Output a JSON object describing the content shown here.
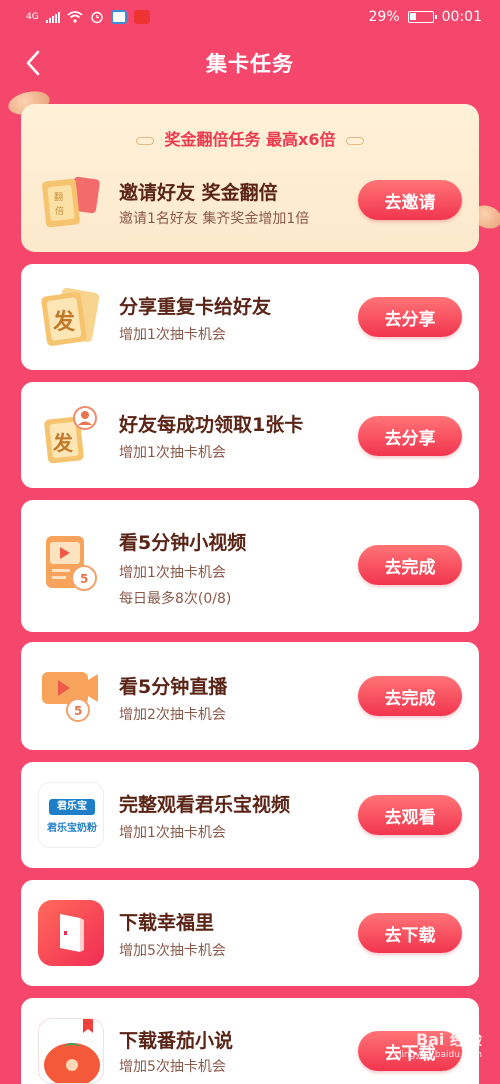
{
  "status_bar": {
    "network": "4G",
    "battery": "29%",
    "time": "00:01"
  },
  "header": {
    "title": "集卡任务"
  },
  "bonus": {
    "title": "奖金翻倍任务 最高x6倍",
    "task": {
      "name": "邀请好友 奖金翻倍",
      "sub": "邀请1名好友 集齐奖金增加1倍",
      "button": "去邀请",
      "icon": "invite-cards-icon"
    }
  },
  "tasks": [
    {
      "name": "分享重复卡给好友",
      "sub": "增加1次抽卡机会",
      "button": "去分享",
      "icon": "share-card-icon",
      "glyph": "发"
    },
    {
      "name": "好友每成功领取1张卡",
      "sub": "增加1次抽卡机会",
      "button": "去分享",
      "icon": "friend-card-icon",
      "glyph": "发"
    },
    {
      "name": "看5分钟小视频",
      "sub": "增加1次抽卡机会",
      "sub2": "每日最多8次(0/8)",
      "button": "去完成",
      "icon": "short-video-icon"
    },
    {
      "name": "看5分钟直播",
      "sub": "增加2次抽卡机会",
      "button": "去完成",
      "icon": "live-stream-icon"
    },
    {
      "name": "完整观看君乐宝视频",
      "sub": "增加1次抽卡机会",
      "button": "去观看",
      "icon": "junlebao-logo-icon",
      "logo_top": "君乐宝",
      "logo_bottom": "君乐宝奶粉"
    },
    {
      "name": "下载幸福里",
      "sub": "增加5次抽卡机会",
      "button": "去下载",
      "icon": "xingfuli-app-icon"
    },
    {
      "name": "下载番茄小说",
      "sub": "增加5次抽卡机会",
      "button": "去下载",
      "icon": "fanqie-novel-app-icon"
    }
  ],
  "watermark": {
    "text": "Bai 经验",
    "url": "jingyan.baidu.com"
  },
  "colors": {
    "background": "#f5476c",
    "button": "#f2354f",
    "bonus_card": "#fff1d9"
  }
}
